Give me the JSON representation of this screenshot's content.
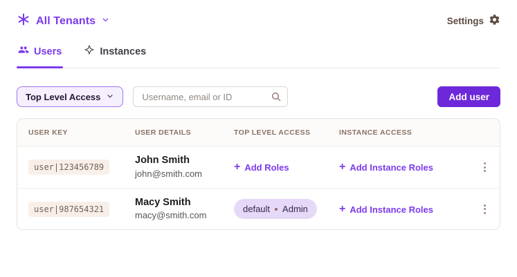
{
  "colors": {
    "accent_purple": "#7c3aed",
    "button_purple": "#6d28d9",
    "badge_bg": "#e6d9f8",
    "warm_gray_text": "#5d4a43",
    "chip_bg": "#f8efe9"
  },
  "icons": {
    "logo": "asterisk-icon",
    "plus": "+",
    "dropdown_chevron": "chevron-down-icon",
    "settings": "gear-icon",
    "search": "magnifier-icon",
    "row_menu": "kebab-vertical-icon"
  },
  "header": {
    "tenant_label": "All Tenants",
    "settings_label": "Settings"
  },
  "tabs": [
    {
      "label": "Users",
      "icon": "users-icon",
      "active": true
    },
    {
      "label": "Instances",
      "icon": "sparkle-icon",
      "active": false
    }
  ],
  "controls": {
    "filter_label": "Top Level Access",
    "search_placeholder": "Username, email or ID",
    "search_value": "",
    "add_user_label": "Add user"
  },
  "table": {
    "columns": [
      "USER KEY",
      "USER DETAILS",
      "TOP LEVEL ACCESS",
      "INSTANCE ACCESS"
    ],
    "rows": [
      {
        "user_key": "user|123456789",
        "name": "John Smith",
        "email": "john@smith.com",
        "top_level_access_link": "Add Roles",
        "instance_access_link": "Add Instance Roles"
      },
      {
        "user_key": "user|987654321",
        "name": "Macy Smith",
        "email": "macy@smith.com",
        "badge": {
          "environment": "default",
          "role": "Admin"
        },
        "instance_access_link": "Add Instance Roles"
      }
    ]
  }
}
